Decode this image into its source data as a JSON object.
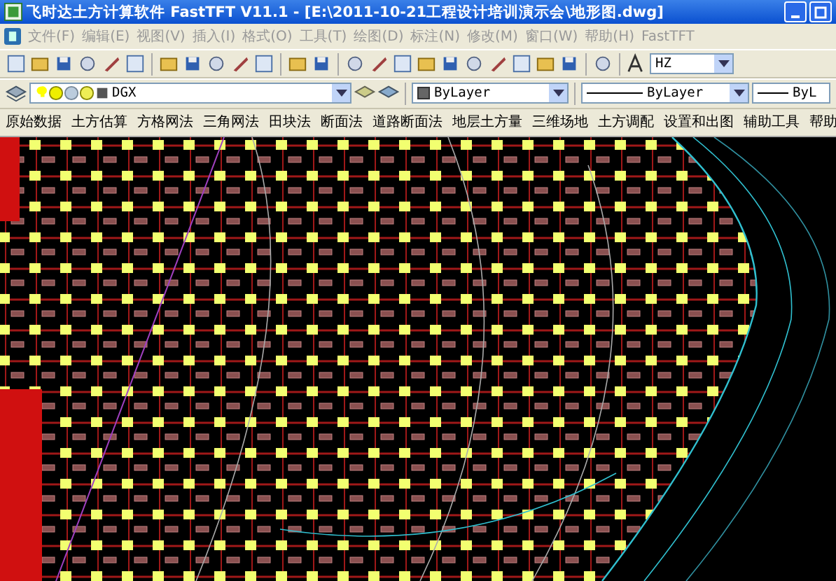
{
  "window": {
    "title": "飞时达土方计算软件 FastTFT V11.1 - [E:\\2011-10-21工程设计培训演示会\\地形图.dwg]"
  },
  "menu_bar": [
    {
      "label": "文件(F)",
      "disabled": true
    },
    {
      "label": "编辑(E)",
      "disabled": true
    },
    {
      "label": "视图(V)",
      "disabled": true
    },
    {
      "label": "插入(I)",
      "disabled": true
    },
    {
      "label": "格式(O)",
      "disabled": true
    },
    {
      "label": "工具(T)",
      "disabled": true
    },
    {
      "label": "绘图(D)",
      "disabled": true
    },
    {
      "label": "标注(N)",
      "disabled": true
    },
    {
      "label": "修改(M)",
      "disabled": true
    },
    {
      "label": "窗口(W)",
      "disabled": true
    },
    {
      "label": "帮助(H)",
      "disabled": true
    },
    {
      "label": "FastTFT",
      "disabled": true
    }
  ],
  "text_style": {
    "value": "HZ"
  },
  "layer": {
    "value": "DGX"
  },
  "color": {
    "value": "ByLayer"
  },
  "linetype": {
    "value": "ByLayer"
  },
  "lineweight": {
    "value": "ByL"
  },
  "tft_menu": [
    "原始数据",
    "土方估算",
    "方格网法",
    "三角网法",
    "田块法",
    "断面法",
    "道路断面法",
    "地层土方量",
    "三维场地",
    "土方调配",
    "设置和出图",
    "辅助工具",
    "帮助"
  ]
}
